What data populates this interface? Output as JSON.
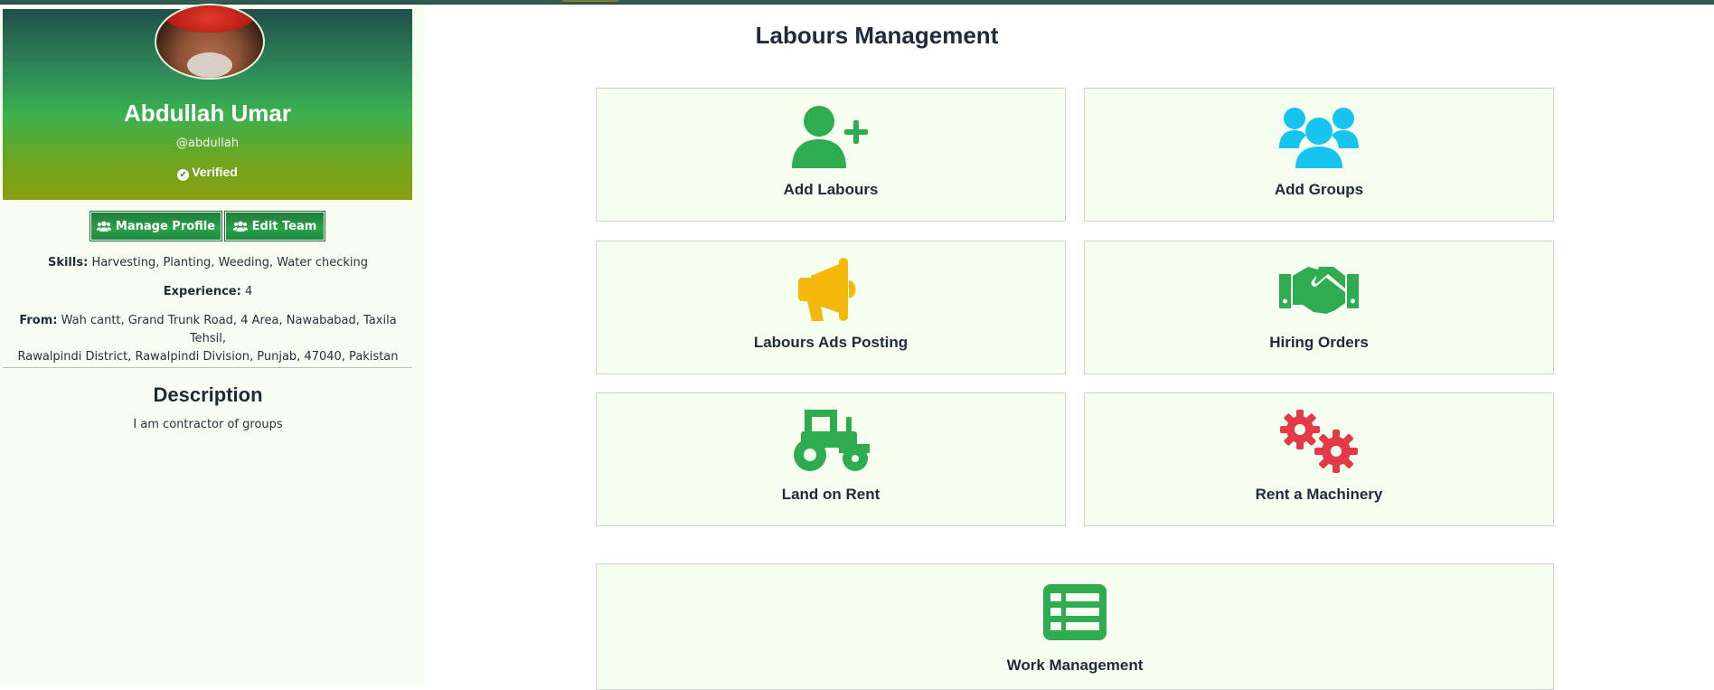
{
  "profile": {
    "name": "Abdullah Umar",
    "handle": "@abdullah",
    "verified_label": "Verified",
    "buttons": {
      "manage_profile": "Manage Profile",
      "edit_team": "Edit Team"
    },
    "skills_label": "Skills:",
    "skills": "Harvesting, Planting, Weeding, Water checking",
    "experience_label": "Experience:",
    "experience": "4",
    "from_label": "From:",
    "from_line1": "Wah cantt, Grand Trunk Road, 4 Area, Nawababad, Taxila Tehsil,",
    "from_line2": "Rawalpindi District, Rawalpindi Division, Punjab, 47040, Pakistan",
    "description_title": "Description",
    "description": "I am contractor of groups"
  },
  "main": {
    "title": "Labours Management",
    "cards": [
      {
        "label": "Add Labours",
        "icon": "add-user-icon",
        "color": "#2eac4f"
      },
      {
        "label": "Add Groups",
        "icon": "users-icon",
        "color": "#17c4ef"
      },
      {
        "label": "Labours Ads Posting",
        "icon": "megaphone-icon",
        "color": "#f5b70a"
      },
      {
        "label": "Hiring Orders",
        "icon": "handshake-icon",
        "color": "#2eac4f"
      },
      {
        "label": "Land on Rent",
        "icon": "tractor-icon",
        "color": "#2eac4f"
      },
      {
        "label": "Rent a Machinery",
        "icon": "gears-icon",
        "color": "#e23a47"
      },
      {
        "label": "Work Management",
        "icon": "list-icon",
        "color": "#2eac4f"
      }
    ]
  },
  "colors": {
    "accent_green": "#2eac4f",
    "card_bg": "#f6fff0",
    "sidebar_bg": "#f8fff2",
    "title_text": "#1e2b3c"
  }
}
